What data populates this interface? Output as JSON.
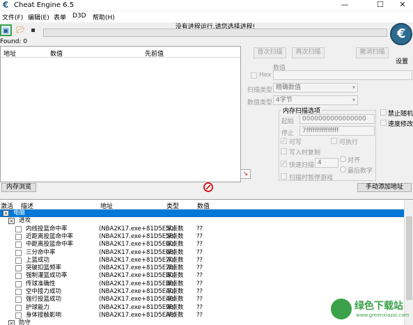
{
  "window": {
    "title": "Cheat Engine 6.5",
    "controls": {
      "minimize": "—",
      "maximize": "☐",
      "close": "✕"
    }
  },
  "menu": {
    "items": [
      "文件(F)",
      "编辑(E)",
      "表单",
      "D3D",
      "帮助(H)"
    ]
  },
  "toolbar": {
    "icons": [
      "open-process-icon",
      "open-file-icon",
      "save-icon"
    ]
  },
  "status": {
    "process_text": "没有进程运行.请您选择进程!",
    "found": "Found: 0",
    "settings_label": "设置"
  },
  "results": {
    "columns": [
      "地址",
      "数值",
      "先前值"
    ]
  },
  "scan": {
    "first_scan": "首次扫描",
    "next_scan": "再次扫描",
    "undo_scan": "撤消扫描",
    "value_label": "数值",
    "hex_label": "Hex",
    "scan_type_label": "扫描类型",
    "scan_type_value": "精确数值",
    "value_type_label": "数值类型",
    "value_type_value": "4字节",
    "memory_options_title": "内存扫描选项",
    "start_label": "起始",
    "start_value": "0000000000000000",
    "stop_label": "停止",
    "stop_value": "7fffffffffffffff",
    "writable": "可写",
    "executable": "可执行",
    "copy_on_write": "写入时复制",
    "fast_scan": "快速扫描",
    "fast_scan_value": "4",
    "align": "对齐",
    "last_digits": "最后数字",
    "pause_game": "扫描时暂停游戏",
    "disable_random": "禁止随机",
    "speed_hack": "速度修改"
  },
  "bottom_buttons": {
    "memory_view": "内存浏览",
    "add_address": "手动添加地址"
  },
  "table": {
    "columns": [
      "激活",
      "描述",
      "地址",
      "类型",
      "数值"
    ],
    "rows": [
      {
        "desc": "电脑",
        "addr": "",
        "type": "",
        "value": "",
        "level": 0,
        "group": true,
        "selected": true
      },
      {
        "desc": "进攻",
        "addr": "",
        "type": "",
        "value": "",
        "level": 1,
        "group": true,
        "selected": false
      },
      {
        "desc": "内线投篮命中率",
        "addr": "(NBA2K17.exe+81D5E50)",
        "type": "浮点数",
        "value": "??",
        "level": 2
      },
      {
        "desc": "近距离投篮命中率",
        "addr": "(NBA2K17.exe+81D5E58)",
        "type": "浮点数",
        "value": "??",
        "level": 2
      },
      {
        "desc": "中距离投篮命中率",
        "addr": "(NBA2K17.exe+81D5E60)",
        "type": "浮点数",
        "value": "??",
        "level": 2
      },
      {
        "desc": "三分命中率",
        "addr": "(NBA2K17.exe+81D5E68)",
        "type": "浮点数",
        "value": "??",
        "level": 2
      },
      {
        "desc": "上篮成功",
        "addr": "(NBA2K17.exe+81D5E70)",
        "type": "浮点数",
        "value": "??",
        "level": 2
      },
      {
        "desc": "突破扣篮频率",
        "addr": "(NBA2K17.exe+81D5E78)",
        "type": "浮点数",
        "value": "??",
        "level": 2
      },
      {
        "desc": "强制灌篮成功率",
        "addr": "(NBA2K17.exe+81D5E80)",
        "type": "浮点数",
        "value": "??",
        "level": 2
      },
      {
        "desc": "传球准确性",
        "addr": "(NBA2K17.exe+81D5E88)",
        "type": "浮点数",
        "value": "??",
        "level": 2
      },
      {
        "desc": "空中接力成功",
        "addr": "(NBA2K17.exe+81D5E40)",
        "type": "浮点数",
        "value": "??",
        "level": 2
      },
      {
        "desc": "强行投篮成功",
        "addr": "(NBA2K17.exe+81D5E48)",
        "type": "浮点数",
        "value": "??",
        "level": 2
      },
      {
        "desc": "护球能力",
        "addr": "(NBA2K17.exe+81D5E98)",
        "type": "浮点数",
        "value": "??",
        "level": 2
      },
      {
        "desc": "身体接触影响",
        "addr": "(NBA2K17.exe+81D5EA8)",
        "type": "浮点数",
        "value": "??",
        "level": 2
      },
      {
        "desc": "防守",
        "addr": "",
        "type": "",
        "value": "",
        "level": 1,
        "group": true,
        "selected": false
      }
    ]
  },
  "watermark": {
    "name": "绿色下载站",
    "url": "www.greenxiazai.com"
  },
  "colors": {
    "selection": "#0078d7",
    "logo": "#2c6b8f",
    "watermark_green": "#3aa14a"
  }
}
